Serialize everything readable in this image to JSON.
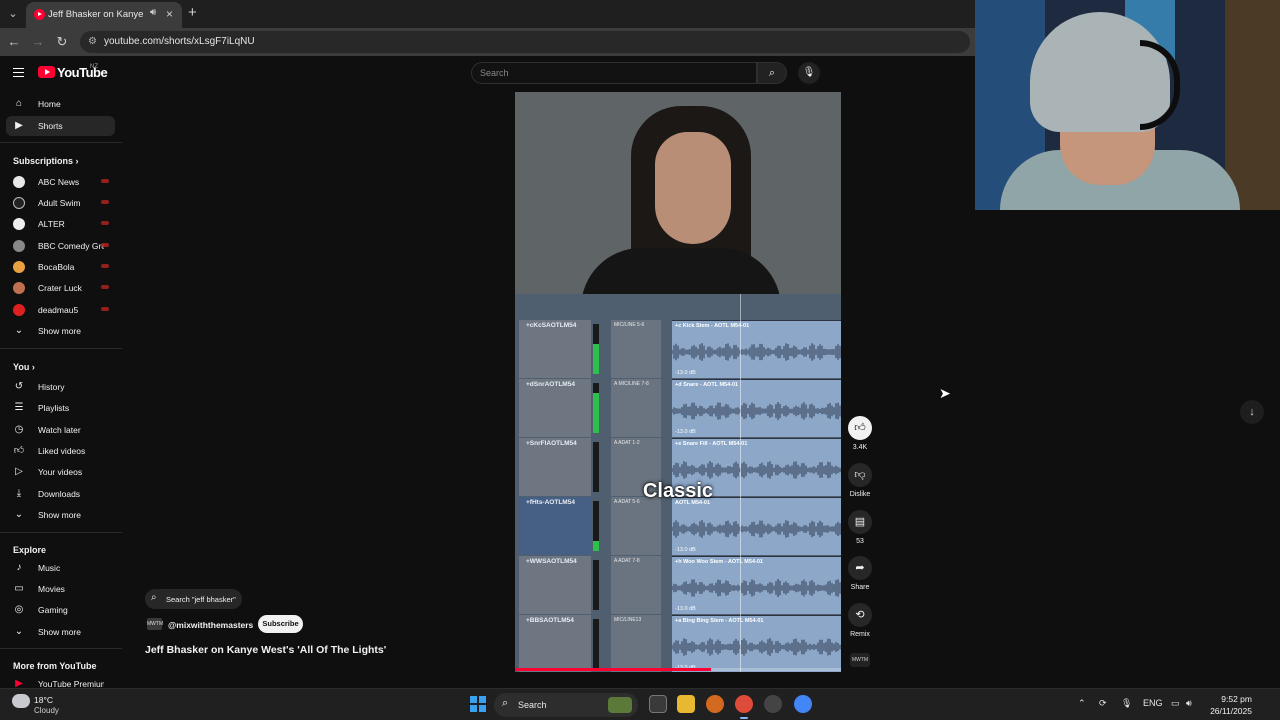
{
  "browser": {
    "tab_title": "Jeff Bhasker on Kanye West's",
    "url": "youtube.com/shorts/xLsgF7iLqNU"
  },
  "youtube": {
    "logo_text": "YouTube",
    "country_code": "NZ",
    "search_placeholder": "Search"
  },
  "sidebar": {
    "main": [
      {
        "label": "Home",
        "icon": "home-icon"
      },
      {
        "label": "Shorts",
        "icon": "shorts-icon",
        "active": true
      }
    ],
    "subscriptions_heading": "Subscriptions",
    "subscriptions": [
      {
        "label": "ABC News",
        "color": "#e8e8e8"
      },
      {
        "label": "Adult Swim",
        "color": "#222222"
      },
      {
        "label": "ALTER",
        "color": "#eeeeee"
      },
      {
        "label": "BBC Comedy Gre...",
        "color": "#888888"
      },
      {
        "label": "BocaBola",
        "color": "#e8a040"
      },
      {
        "label": "Crater Luck",
        "color": "#c07050"
      },
      {
        "label": "deadmau5",
        "color": "#e02020"
      }
    ],
    "show_more": "Show more",
    "you_heading": "You",
    "you_items": [
      {
        "label": "History",
        "icon": "history-icon"
      },
      {
        "label": "Playlists",
        "icon": "playlists-icon"
      },
      {
        "label": "Watch later",
        "icon": "watch-later-icon"
      },
      {
        "label": "Liked videos",
        "icon": "like-icon"
      },
      {
        "label": "Your videos",
        "icon": "your-videos-icon"
      },
      {
        "label": "Downloads",
        "icon": "download-icon"
      }
    ],
    "explore_heading": "Explore",
    "explore_items": [
      {
        "label": "Music",
        "icon": "music-icon"
      },
      {
        "label": "Movies",
        "icon": "movies-icon"
      },
      {
        "label": "Gaming",
        "icon": "gaming-icon"
      }
    ],
    "more_heading": "More from YouTube",
    "more_items": [
      {
        "label": "YouTube Premium",
        "icon": "youtube-premium-icon"
      }
    ]
  },
  "short": {
    "caption": "Classic",
    "search_chip": "Search \"jeff bhasker\"",
    "channel": "@mixwiththemasters",
    "channel_avatar": "MWTM",
    "subscribe": "Subscribe",
    "title": "Jeff Bhasker on Kanye West's 'All Of The Lights'",
    "progress": 0.6,
    "actions": {
      "like_count": "3.4K",
      "dislike": "Dislike",
      "comments": "53",
      "share": "Share",
      "remix": "Remix"
    },
    "daw_tracks": [
      {
        "name": "+cKcSAOTLM54",
        "io": "MIC/LINE 5-6",
        "clip": "+c Kick Stem - AOTL M54-01",
        "db": "-13.0 dB",
        "selected": false,
        "level": 0.6
      },
      {
        "name": "+dSnrAOTLM54",
        "io": "A MIC/LINE 7-8",
        "clip": "+d Snare - AOTL M54-01",
        "db": "-13.0 dB",
        "selected": false,
        "level": 0.8
      },
      {
        "name": "+SnrFlAOTLM54",
        "io": "A ADAT 1-2",
        "clip": "+e Snare Fill - AOTL M54-01",
        "db": "-13.0 dB",
        "selected": false,
        "level": 0
      },
      {
        "name": "+fHts-AOTLM54",
        "io": "A ADAT 5-6",
        "clip": "AOTL M54-01",
        "db": "-13.0 dB",
        "selected": true,
        "level": 0.2
      },
      {
        "name": "+WWSAOTLM54",
        "io": "A ADAT 7-8",
        "clip": "+h Woo Woo Stem - AOTL M54-01",
        "db": "-13.0 dB",
        "selected": false,
        "level": 0
      },
      {
        "name": "+BBSAOTLM54",
        "io": "MIC/LINE13",
        "clip": "+a Bing Bing Stem - AOTL M54-01",
        "db": "-13.0 dB",
        "selected": false,
        "level": 0
      }
    ]
  },
  "taskbar": {
    "weather_temp": "18°C",
    "weather_cond": "Cloudy",
    "search": "Search",
    "lang": "ENG",
    "time": "9:52 pm",
    "date": "26/11/2025"
  },
  "colors": {
    "accent": "#ff0033",
    "background": "#0f0f0f"
  }
}
